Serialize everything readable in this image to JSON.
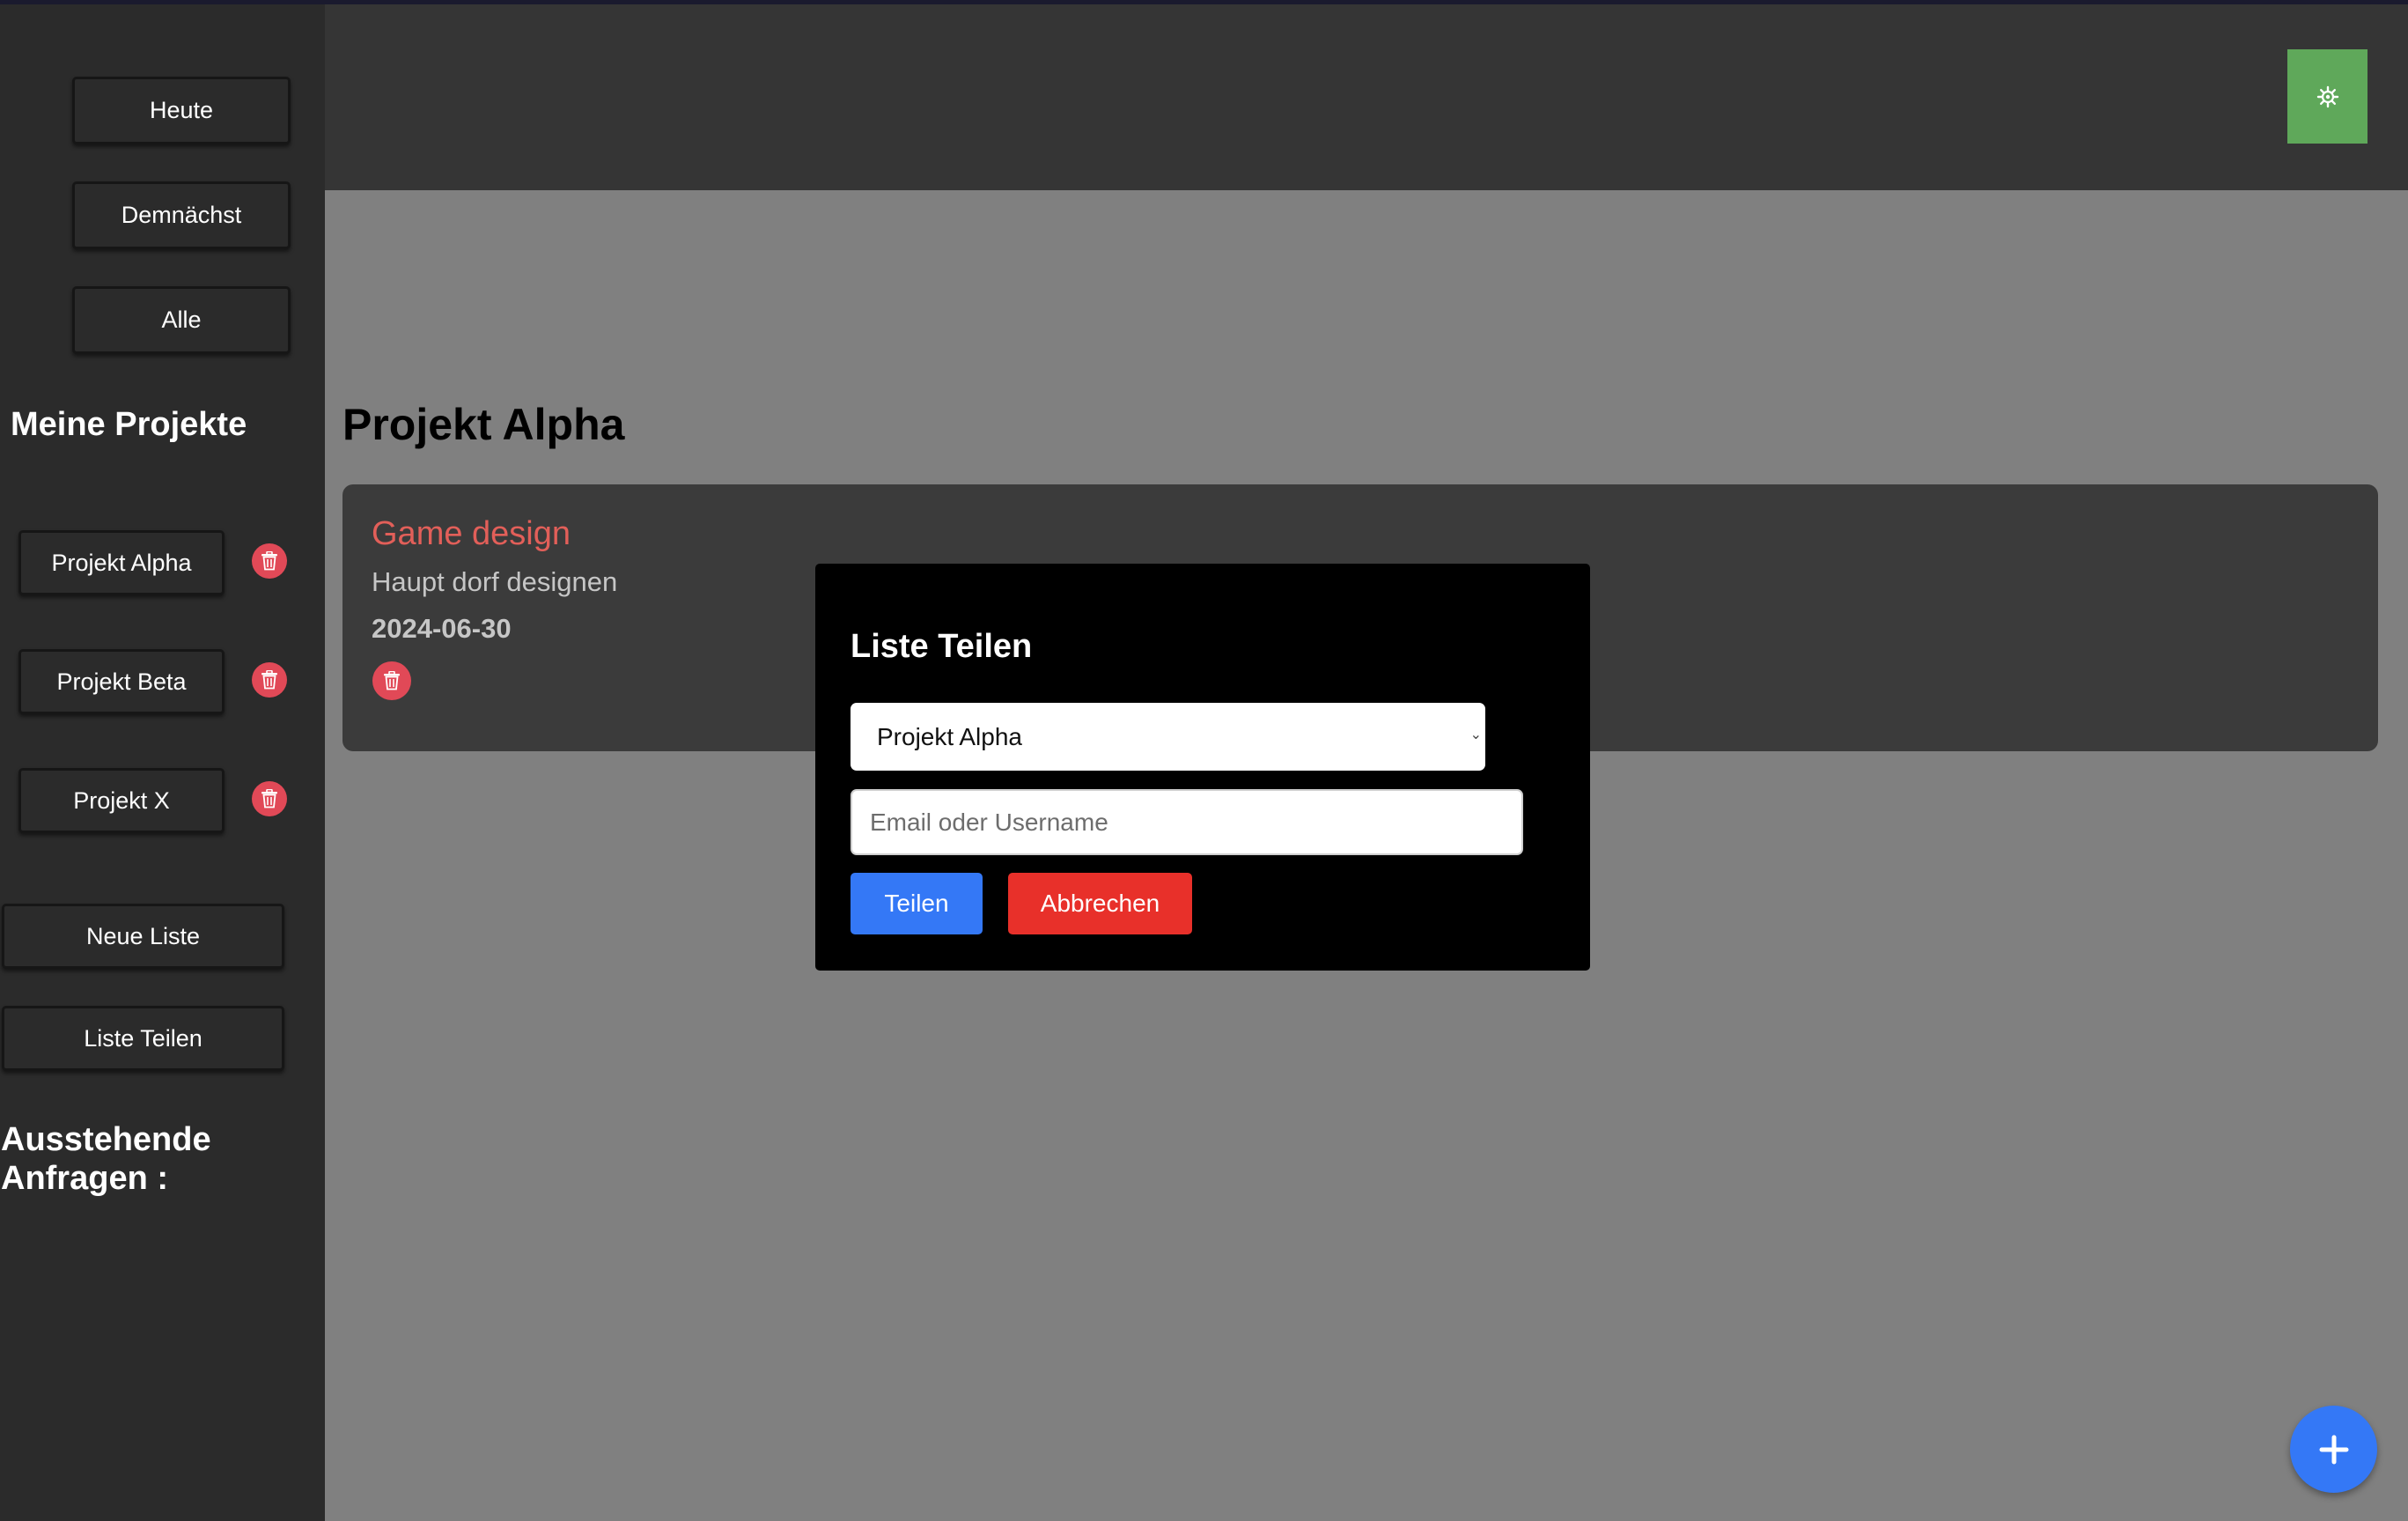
{
  "sidebar": {
    "nav": [
      {
        "label": "Heute"
      },
      {
        "label": "Demnächst"
      },
      {
        "label": "Alle"
      }
    ],
    "projects_heading": "Meine Projekte",
    "projects": [
      {
        "label": "Projekt Alpha"
      },
      {
        "label": "Projekt Beta"
      },
      {
        "label": "Projekt X"
      }
    ],
    "new_list_label": "Neue Liste",
    "share_list_label": "Liste Teilen",
    "pending_heading_line1": "Ausstehende",
    "pending_heading_line2": "Anfragen :"
  },
  "header": {
    "settings_icon": "gear-icon"
  },
  "main": {
    "title": "Projekt Alpha",
    "task": {
      "title": "Game design",
      "description": "Haupt dorf designen",
      "date": "2024-06-30"
    }
  },
  "modal": {
    "title": "Liste Teilen",
    "select_value": "Projekt Alpha",
    "input_placeholder": "Email oder Username",
    "input_value": "",
    "share_label": "Teilen",
    "cancel_label": "Abbrechen"
  },
  "colors": {
    "accent_green": "#5fa85a",
    "accent_blue": "#3478f6",
    "danger_red": "#e8302a",
    "trash_red": "#e14957",
    "task_title": "#e25f59"
  }
}
